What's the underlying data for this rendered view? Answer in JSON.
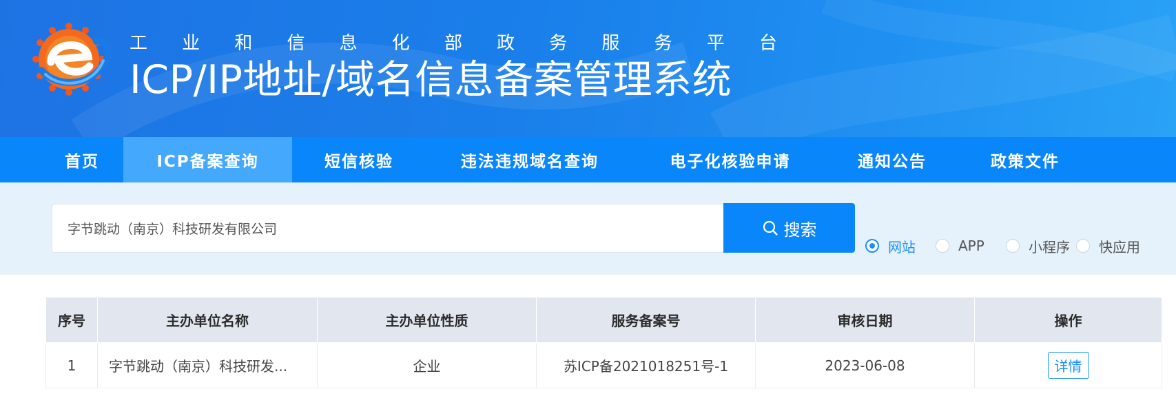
{
  "header": {
    "subtitle_chars": [
      "工",
      "业",
      "和",
      "信",
      "息",
      "化",
      "部",
      "政",
      "务",
      "服",
      "务",
      "平",
      "台"
    ],
    "title": "ICP/IP地址/域名信息备案管理系统"
  },
  "nav": {
    "items": [
      {
        "label": "首页",
        "active": false
      },
      {
        "label": "ICP备案查询",
        "active": true
      },
      {
        "label": "短信核验",
        "active": false
      },
      {
        "label": "违法违规域名查询",
        "active": false
      },
      {
        "label": "电子化核验申请",
        "active": false
      },
      {
        "label": "通知公告",
        "active": false
      },
      {
        "label": "政策文件",
        "active": false
      }
    ]
  },
  "search": {
    "value": "字节跳动（南京）科技研发有限公司",
    "button_label": "搜索",
    "types": [
      {
        "label": "网站",
        "checked": true
      },
      {
        "label": "APP",
        "checked": false
      },
      {
        "label": "小程序",
        "checked": false
      },
      {
        "label": "快应用",
        "checked": false
      }
    ]
  },
  "table": {
    "columns": [
      "序号",
      "主办单位名称",
      "主办单位性质",
      "服务备案号",
      "审核日期",
      "操作"
    ],
    "rows": [
      {
        "index": "1",
        "org_name": "字节跳动（南京）科技研发...",
        "org_type": "企业",
        "record_no": "苏ICP备2021018251号-1",
        "audit_date": "2023-06-08",
        "action": "详情"
      }
    ]
  },
  "colors": {
    "nav_bg": "#0a86fb",
    "nav_active": "#44a9fc",
    "accent": "#1890ff",
    "search_area_bg": "#e5f1fb",
    "table_header_bg": "#e1e6ef"
  },
  "icons": {
    "logo": "miit-e-logo-icon",
    "search": "magnifier-icon"
  }
}
